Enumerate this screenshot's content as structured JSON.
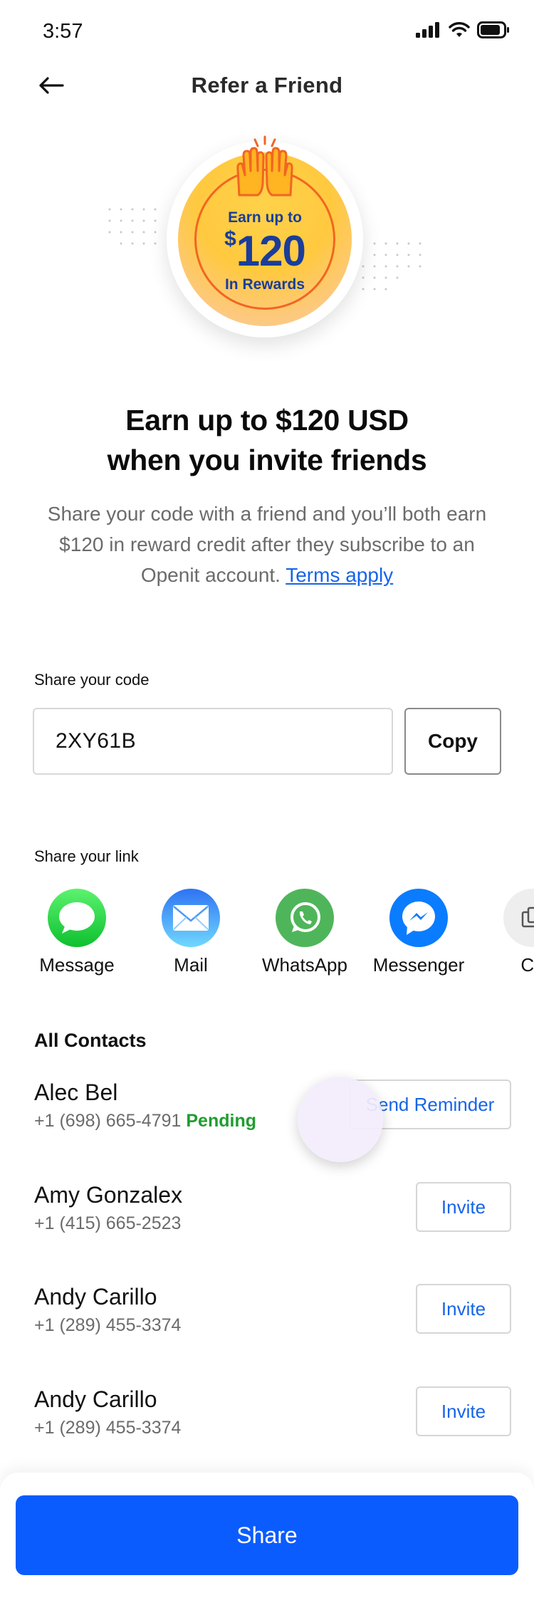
{
  "status_bar": {
    "time": "3:57"
  },
  "nav": {
    "title": "Refer a Friend"
  },
  "badge": {
    "line1": "Earn up to",
    "currency": "$",
    "amount": "120",
    "line3": "In Rewards"
  },
  "headline": {
    "line1": "Earn up to $120 USD",
    "line2": "when you invite friends"
  },
  "subtext": {
    "body": "Share your code with a friend and you’ll both earn $120 in reward credit after they subscribe to an Openit account.",
    "link": "Terms apply"
  },
  "share_code": {
    "label": "Share your code",
    "value": "2XY61B",
    "copy_label": "Copy"
  },
  "share_link": {
    "label": "Share your link",
    "apps": [
      {
        "label": "Message",
        "icon": "message-icon",
        "color": "#1fc43c"
      },
      {
        "label": "Mail",
        "icon": "mail-icon",
        "color": "#3d8bf5"
      },
      {
        "label": "WhatsApp",
        "icon": "whatsapp-icon",
        "color": "#4caf50"
      },
      {
        "label": "Messenger",
        "icon": "messenger-icon",
        "color": "#0a7cff"
      },
      {
        "label": "Co",
        "icon": "copy-icon",
        "color": "#eeeeee"
      }
    ]
  },
  "contacts": {
    "title": "All Contacts",
    "items": [
      {
        "name": "Alec Bel",
        "phone": "+1 (698) 665-4791",
        "status": "Pending",
        "action": "Send Reminder"
      },
      {
        "name": "Amy Gonzalex",
        "phone": "+1 (415) 665-2523",
        "status": "",
        "action": "Invite"
      },
      {
        "name": "Andy Carillo",
        "phone": "+1 (289) 455-3374",
        "status": "",
        "action": "Invite"
      },
      {
        "name": "Andy Carillo",
        "phone": "+1 (289) 455-3374",
        "status": "",
        "action": "Invite"
      }
    ]
  },
  "footer": {
    "share_label": "Share"
  }
}
